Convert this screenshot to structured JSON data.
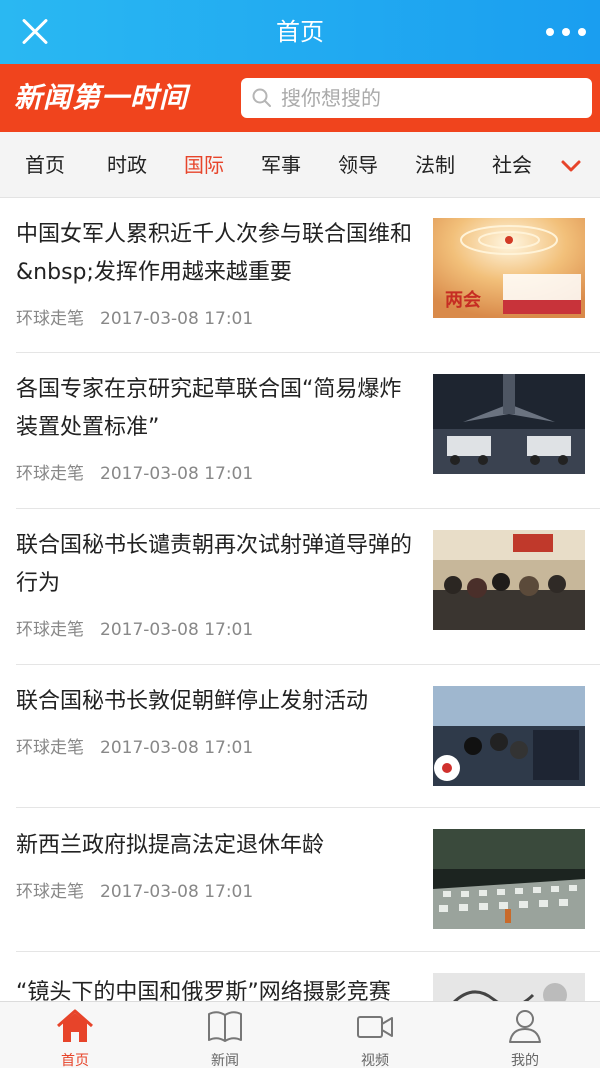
{
  "header": {
    "title": "首页",
    "close_icon": "close-icon",
    "more_icon": "more-icon"
  },
  "brand": {
    "logo_text": "新闻第一时间"
  },
  "search": {
    "placeholder": "搜你想搜的",
    "icon": "search-icon"
  },
  "nav": {
    "tabs": [
      {
        "label": "首页",
        "active": false
      },
      {
        "label": "时政",
        "active": false
      },
      {
        "label": "国际",
        "active": true
      },
      {
        "label": "军事",
        "active": false
      },
      {
        "label": "领导",
        "active": false
      },
      {
        "label": "法制",
        "active": false
      },
      {
        "label": "社会",
        "active": false
      }
    ],
    "expand_icon": "chevron-down-icon"
  },
  "articles": [
    {
      "title": "中国女军人累积近千人次参与联合国维和&nbsp;发挥作用越来越重要",
      "source": "环球走笔",
      "time": "2017-03-08 17:01",
      "thumb_caption": "两会"
    },
    {
      "title": "各国专家在京研究起草联合国“简易爆炸装置处置标准”",
      "source": "环球走笔",
      "time": "2017-03-08 17:01"
    },
    {
      "title": "联合国秘书长谴责朝再次试射弹道导弹的行为",
      "source": "环球走笔",
      "time": "2017-03-08 17:01"
    },
    {
      "title": "联合国秘书长敦促朝鲜停止发射活动",
      "source": "环球走笔",
      "time": "2017-03-08 17:01"
    },
    {
      "title": "新西兰政府拟提高法定退休年龄",
      "source": "环球走笔",
      "time": "2017-03-08 17:01"
    },
    {
      "title": "“镜头下的中国和俄罗斯”网络摄影竞赛"
    }
  ],
  "tabbar": [
    {
      "label": "首页",
      "icon": "home-icon",
      "active": true
    },
    {
      "label": "新闻",
      "icon": "book-icon",
      "active": false
    },
    {
      "label": "视频",
      "icon": "video-camera-icon",
      "active": false
    },
    {
      "label": "我的",
      "icon": "user-icon",
      "active": false
    }
  ],
  "colors": {
    "header_blue": "#1a9ef0",
    "brand_red": "#f0441d",
    "accent_red": "#e7442a"
  }
}
